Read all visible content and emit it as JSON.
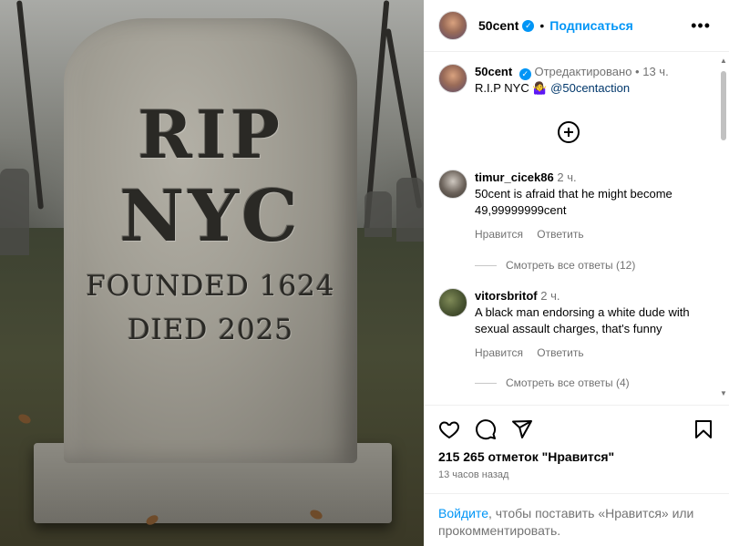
{
  "photo": {
    "line1": "RIP",
    "line2": "NYC",
    "line3": "FOUNDED 1624",
    "line4": "DIED 2025"
  },
  "header": {
    "username": "50cent",
    "verified_glyph": "✓",
    "separator": "•",
    "follow_label": "Подписаться",
    "more_glyph": "•••"
  },
  "caption": {
    "username": "50cent",
    "edited": "Отредактировано",
    "separator": "•",
    "time": "13 ч.",
    "text": "R.I.P NYC 🤷‍♀️",
    "mention": "@50centaction"
  },
  "comments": [
    {
      "username": "timur_cicek86",
      "time": "2 ч.",
      "text": "50cent is afraid that he might become 49,99999999cent",
      "like_label": "Нравится",
      "reply_label": "Ответить",
      "view_replies": "Смотреть все ответы (12)"
    },
    {
      "username": "vitorsbritof",
      "time": "2 ч.",
      "text": "A black man endorsing a white dude with sexual assault charges, that's funny",
      "like_label": "Нравится",
      "reply_label": "Ответить",
      "view_replies": "Смотреть все ответы (4)"
    }
  ],
  "footer": {
    "likes": "215 265 отметок \"Нравится\"",
    "time_ago": "13 часов назад",
    "login_link": "Войдите",
    "login_rest": ", чтобы поставить «Нравится» или прокомментировать."
  },
  "icons": [
    "heart-icon",
    "comment-icon",
    "share-icon",
    "bookmark-icon",
    "add-comment-icon",
    "more-icon"
  ],
  "colors": {
    "accent": "#0095f6",
    "muted": "#737373",
    "link": "#00376b"
  }
}
